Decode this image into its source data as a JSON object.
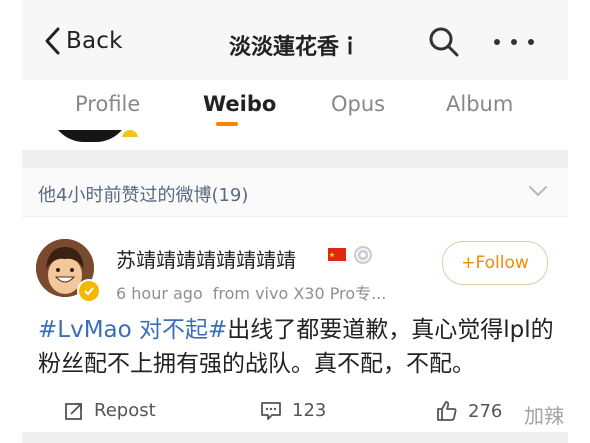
{
  "header": {
    "back_label": "Back",
    "title": "淡淡蓮花香ｉ"
  },
  "tabs": [
    {
      "label": "Profile"
    },
    {
      "label": "Weibo",
      "active": true
    },
    {
      "label": "Opus"
    },
    {
      "label": "Album"
    }
  ],
  "liked_section": {
    "label": "他4小时前赞过的微博(19)"
  },
  "post": {
    "username": "苏靖靖靖靖靖靖靖靖",
    "follow_label": "+Follow",
    "time": "6 hour ago",
    "source": "from vivo X30 Pro专...",
    "hashtag": "#LvMao 对不起#",
    "text": "出线了都要道歉，真心觉得lpl的粉丝配不上拥有强的战队。真不配，不配。",
    "repost_label": "Repost",
    "comment_count": "123",
    "like_count": "276"
  },
  "watermark": "加辣",
  "colors": {
    "accent": "#ff8200",
    "link": "#3a6fb7",
    "follow": "#ef8c00"
  }
}
